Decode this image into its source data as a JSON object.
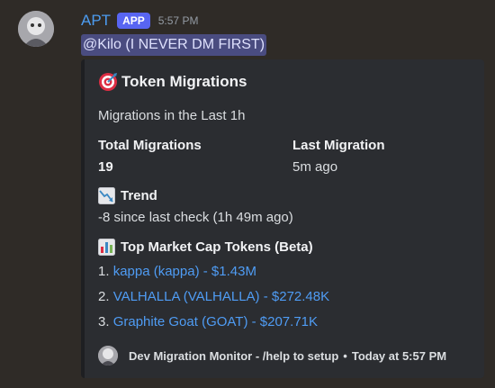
{
  "message": {
    "author": "APT",
    "badge": "APP",
    "time": "5:57 PM",
    "mention": "@Kilo (I NEVER DM FIRST)"
  },
  "embed": {
    "title": "Token Migrations",
    "title_icon": "target-icon",
    "description": "Migrations in the Last 1h",
    "fields": [
      {
        "name": "Total Migrations",
        "value": "19"
      },
      {
        "name": "Last Migration",
        "value": "5m ago"
      }
    ],
    "trend": {
      "icon": "chart-decreasing-icon",
      "title": "Trend",
      "value": "-8 since last check (1h 49m ago)"
    },
    "top_tokens": {
      "icon": "bar-chart-icon",
      "title": "Top Market Cap Tokens (Beta)",
      "items": [
        {
          "num": "1.",
          "text": "kappa (kappa) - $1.43M"
        },
        {
          "num": "2.",
          "text": "VALHALLA (VALHALLA) - $272.48K"
        },
        {
          "num": "3.",
          "text": "Graphite Goat (GOAT) - $207.71K"
        }
      ]
    },
    "footer": {
      "text": "Dev Migration Monitor - /help to setup",
      "separator": "•",
      "time": "Today at 5:57 PM"
    }
  }
}
